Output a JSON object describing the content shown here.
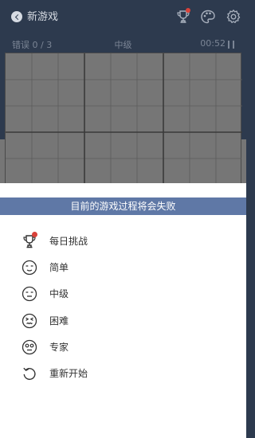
{
  "header": {
    "title": "新游戏",
    "icons": [
      "back-icon",
      "trophy-icon",
      "palette-icon",
      "settings-icon"
    ]
  },
  "status": {
    "mistakes": "错误 0 / 3",
    "difficulty": "中级",
    "timer": "00:52"
  },
  "sheet": {
    "banner": "目前的游戏过程将会失败",
    "items": [
      {
        "label": "每日挑战",
        "icon": "trophy-icon"
      },
      {
        "label": "简单",
        "icon": "face-easy-icon"
      },
      {
        "label": "中级",
        "icon": "face-medium-icon"
      },
      {
        "label": "困难",
        "icon": "face-hard-icon"
      },
      {
        "label": "专家",
        "icon": "face-expert-icon"
      },
      {
        "label": "重新开始",
        "icon": "restart-icon"
      }
    ]
  },
  "colors": {
    "banner": "#5f78a6",
    "header_bg": "#2d3a4e",
    "notification_dot": "#d9423a"
  }
}
